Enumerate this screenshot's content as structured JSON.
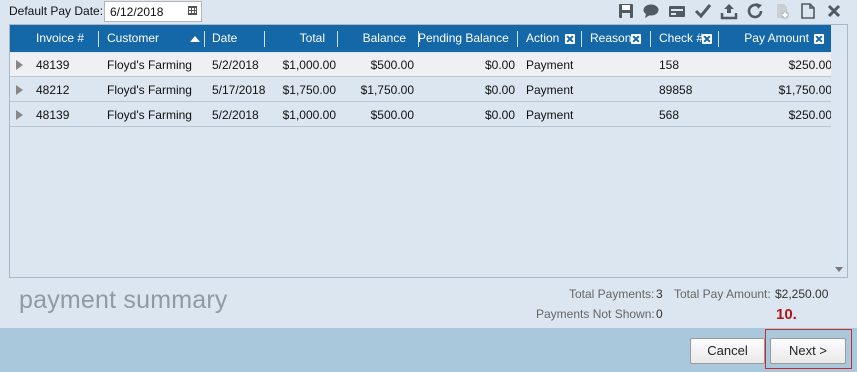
{
  "toolbar": {
    "pay_date_label": "Default Pay Date:",
    "pay_date_value": "6/12/2018",
    "icons": [
      "save-icon",
      "comment-icon",
      "card-icon",
      "check-icon",
      "upload-icon",
      "refresh-icon",
      "add-document-icon",
      "document-icon",
      "close-icon"
    ]
  },
  "grid": {
    "columns": [
      "Invoice #",
      "Customer",
      "Date",
      "Total",
      "Balance",
      "Pending Balance",
      "Action",
      "Reason",
      "Check #",
      "Pay Amount"
    ],
    "rows": [
      {
        "invoice": "48139",
        "customer": "Floyd's Farming",
        "date": "5/2/2018",
        "total": "$1,000.00",
        "balance": "$500.00",
        "pending": "$0.00",
        "action": "Payment",
        "reason": "",
        "check": "158",
        "pay_amount": "$250.00"
      },
      {
        "invoice": "48212",
        "customer": "Floyd's Farming",
        "date": "5/17/2018",
        "total": "$1,750.00",
        "balance": "$1,750.00",
        "pending": "$0.00",
        "action": "Payment",
        "reason": "",
        "check": "89858",
        "pay_amount": "$1,750.00"
      },
      {
        "invoice": "48139",
        "customer": "Floyd's Farming",
        "date": "5/2/2018",
        "total": "$1,000.00",
        "balance": "$500.00",
        "pending": "$0.00",
        "action": "Payment",
        "reason": "",
        "check": "568",
        "pay_amount": "$250.00"
      }
    ]
  },
  "summary": {
    "title": "payment summary",
    "total_payments_label": "Total Payments:",
    "total_payments_value": "3",
    "total_pay_amount_label": "Total Pay Amount:",
    "total_pay_amount_value": "$2,250.00",
    "not_shown_label": "Payments Not Shown:",
    "not_shown_value": "0"
  },
  "footer": {
    "cancel_label": "Cancel",
    "next_label": "Next >",
    "step_badge": "10."
  },
  "colors": {
    "header_bg": "#1468a8",
    "footer_bg": "#aac8dc",
    "highlight": "#c92a2f"
  }
}
